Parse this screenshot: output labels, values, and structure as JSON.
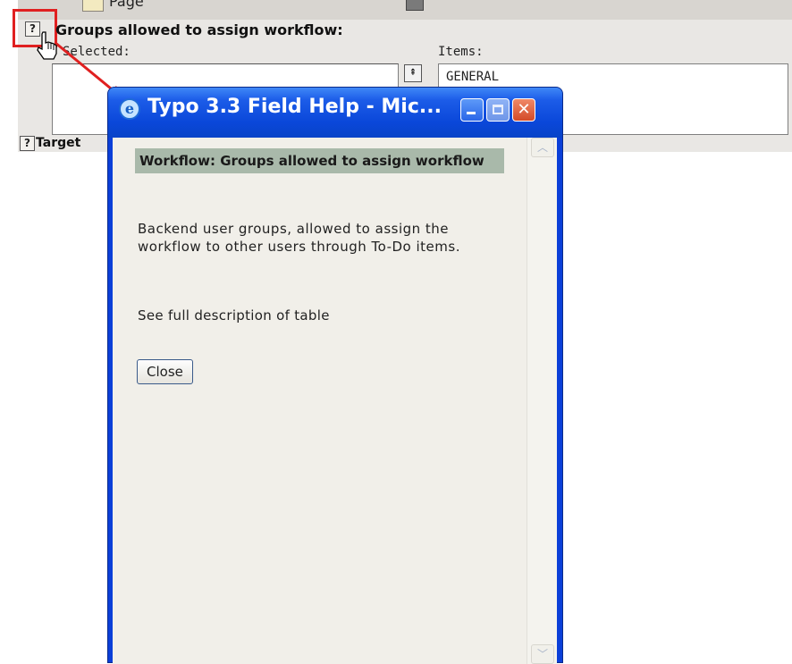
{
  "background_form": {
    "top_field_text": "Page",
    "field_title": "Groups allowed to assign workflow:",
    "selected_label": "Selected:",
    "items_label": "Items:",
    "items": [
      "GENERAL"
    ],
    "help_glyph": "?",
    "next_field_label": "Target",
    "move_top_glyph": "⇞"
  },
  "popup": {
    "title": "Typo 3.3 Field Help - Mic...",
    "icon": "ie-icon",
    "heading": "Workflow: Groups allowed to assign workflow",
    "description": "Backend user groups, allowed to assign the workflow to other users through To-Do items.",
    "link_text": "See full description of table",
    "close_button": "Close",
    "close_glyph": "✕",
    "scroll_up_glyph": "︿",
    "scroll_down_glyph": "﹀"
  },
  "colors": {
    "highlight_red": "#e02020",
    "titlebar_blue": "#0a47d9",
    "heading_bg": "#a9b9aa"
  }
}
